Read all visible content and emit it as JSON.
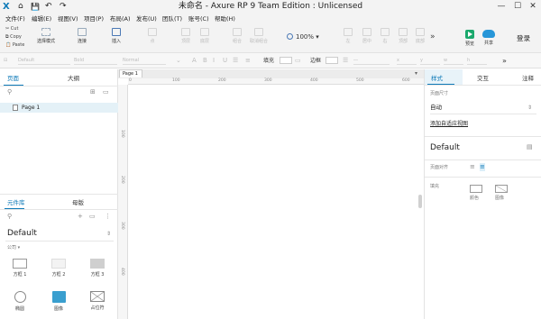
{
  "window": {
    "title": "未命名 - Axure RP 9 Team Edition : Unlicensed",
    "logo_glyph": "X",
    "quick_access": [
      "⌂",
      "💾",
      "↶",
      "↷"
    ],
    "controls": [
      "—",
      "☐",
      "✕"
    ]
  },
  "menu": [
    "文件(F)",
    "编辑(E)",
    "视图(V)",
    "项目(P)",
    "布局(A)",
    "发布(U)",
    "团队(T)",
    "账号(C)",
    "帮助(H)"
  ],
  "toolbar": {
    "clipboard": [
      "Cut",
      "Copy",
      "Paste"
    ],
    "select_mode": "选择模式",
    "connect": "连接",
    "insert": "插入",
    "point": "点",
    "top_layer": "顶层",
    "bottom_layer": "底层",
    "combine": "组合",
    "ungroup": "取消组合",
    "zoom": "100%",
    "left": "左",
    "center": "居中",
    "right": "右",
    "top": "顶部",
    "middle": "中部",
    "bottom": "底部",
    "more": "»",
    "preview": "预览",
    "share": "共享",
    "login": "登录"
  },
  "stylebar": {
    "font_family": "Default",
    "font_weight": "Bold",
    "font_size": "Normal",
    "fill_label": "填充",
    "border_label": "边框",
    "more": "»"
  },
  "left_panel": {
    "tabs": [
      "页面",
      "大纲"
    ],
    "pages": [
      {
        "name": "Page 1"
      }
    ],
    "library_tabs": [
      "元件库",
      "母版"
    ],
    "library_selected": "Default",
    "library_group": "公司 ▾",
    "widgets": [
      {
        "label": "方框 1",
        "shape": "box-gray-border"
      },
      {
        "label": "方框 2",
        "shape": "box-light"
      },
      {
        "label": "方框 3",
        "shape": "box-gray"
      },
      {
        "label": "椭圆",
        "shape": "circle"
      },
      {
        "label": "图像",
        "shape": "image"
      },
      {
        "label": "占位符",
        "shape": "placeholder"
      }
    ]
  },
  "canvas": {
    "tab": "Page 1",
    "ruler_h": [
      "0",
      "100",
      "200",
      "300",
      "400",
      "500",
      "600"
    ],
    "ruler_v": [
      "100",
      "200",
      "300",
      "400"
    ]
  },
  "right_panel": {
    "tabs": [
      "样式",
      "交互",
      "注释"
    ],
    "page_size_label": "页面尺寸",
    "page_size_value": "自动",
    "adaptive_link": "添加自适应视图",
    "style_name": "Default",
    "page_align_label": "页面对齐",
    "fill_label": "填充",
    "fill_color": "颜色",
    "fill_image": "图像"
  },
  "colors": {
    "accent": "#0e7ab8",
    "preview_green": "#1aa86c",
    "share_blue": "#2796d8",
    "selected_row": "#e4f1f7"
  }
}
